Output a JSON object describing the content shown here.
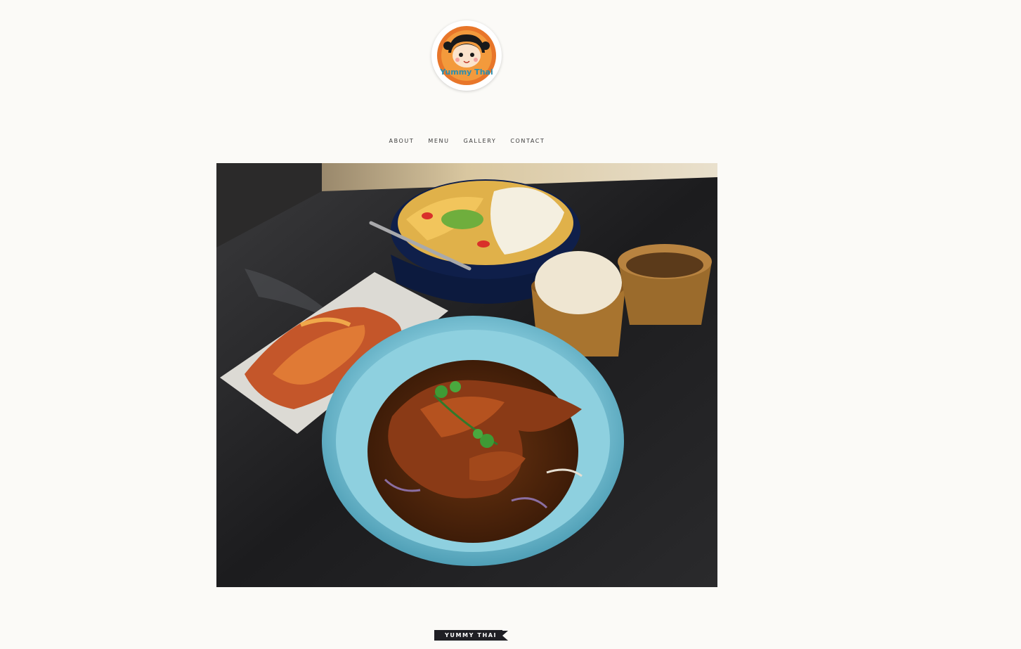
{
  "logo": {
    "alt": "Yummy Thai logo",
    "wordmark": "Yummy Thai",
    "ring_color": "#e8762a",
    "text_color": "#2a8fb0"
  },
  "nav": {
    "items": [
      {
        "label": "ABOUT"
      },
      {
        "label": "MENU"
      },
      {
        "label": "GALLERY"
      },
      {
        "label": "CONTACT"
      }
    ]
  },
  "hero": {
    "alt": "Thai dishes on a dark table: fried chicken in sauce, papaya salad, sticky rice and a side dish"
  },
  "tag": {
    "label": "YUMMY THAI"
  },
  "colors": {
    "background": "#fbfaf7",
    "tag_background": "#1f1f24"
  }
}
